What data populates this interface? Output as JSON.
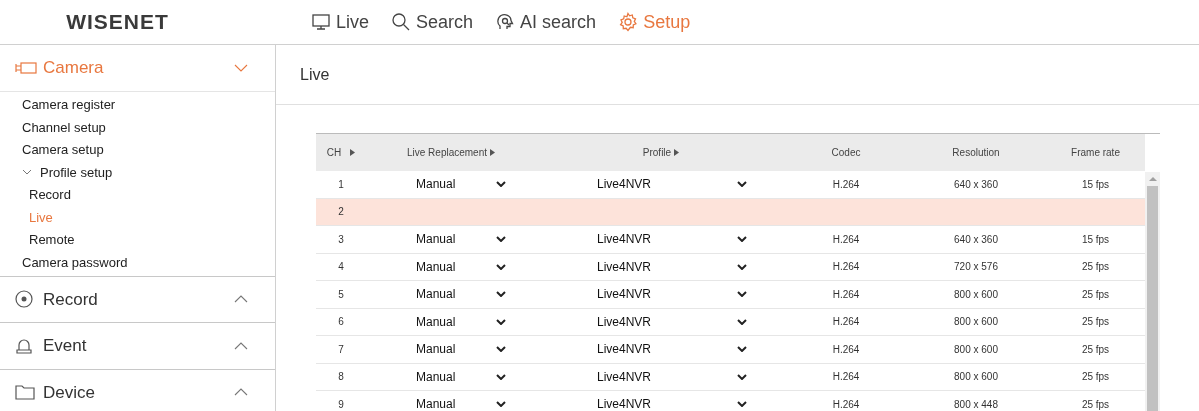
{
  "header": {
    "logo": "WISENET",
    "nav": [
      {
        "label": "Live",
        "selected": false
      },
      {
        "label": "Search",
        "selected": false
      },
      {
        "label": "AI search",
        "selected": false
      },
      {
        "label": "Setup",
        "selected": true
      }
    ]
  },
  "sidebar": {
    "sections": [
      {
        "label": "Camera",
        "expanded": true,
        "items": [
          {
            "label": "Camera register",
            "selected": false
          },
          {
            "label": "Channel setup",
            "selected": false
          },
          {
            "label": "Camera setup",
            "selected": false
          },
          {
            "label": "Profile setup",
            "selected": false,
            "expanded": true,
            "children": [
              {
                "label": "Record",
                "selected": false
              },
              {
                "label": "Live",
                "selected": true
              },
              {
                "label": "Remote",
                "selected": false
              }
            ]
          },
          {
            "label": "Camera password",
            "selected": false
          }
        ]
      },
      {
        "label": "Record",
        "expanded": false
      },
      {
        "label": "Event",
        "expanded": false
      },
      {
        "label": "Device",
        "expanded": false
      }
    ]
  },
  "page_title": "Live",
  "table": {
    "columns": [
      {
        "label": "CH",
        "sortable": true
      },
      {
        "label": "Live Replacement",
        "sortable": true
      },
      {
        "label": "Profile",
        "sortable": true
      },
      {
        "label": "Codec",
        "sortable": false
      },
      {
        "label": "Resolution",
        "sortable": false
      },
      {
        "label": "Frame rate",
        "sortable": false
      }
    ],
    "rows": [
      {
        "ch": "1",
        "selected": false,
        "replacement": "Manual",
        "profile": "Live4NVR",
        "codec": "H.264",
        "resolution": "640 x 360",
        "frame_rate": "15 fps"
      },
      {
        "ch": "2",
        "selected": true
      },
      {
        "ch": "3",
        "selected": false,
        "replacement": "Manual",
        "profile": "Live4NVR",
        "codec": "H.264",
        "resolution": "640 x 360",
        "frame_rate": "15 fps"
      },
      {
        "ch": "4",
        "selected": false,
        "replacement": "Manual",
        "profile": "Live4NVR",
        "codec": "H.264",
        "resolution": "720 x 576",
        "frame_rate": "25 fps"
      },
      {
        "ch": "5",
        "selected": false,
        "replacement": "Manual",
        "profile": "Live4NVR",
        "codec": "H.264",
        "resolution": "800 x 600",
        "frame_rate": "25 fps"
      },
      {
        "ch": "6",
        "selected": false,
        "replacement": "Manual",
        "profile": "Live4NVR",
        "codec": "H.264",
        "resolution": "800 x 600",
        "frame_rate": "25 fps"
      },
      {
        "ch": "7",
        "selected": false,
        "replacement": "Manual",
        "profile": "Live4NVR",
        "codec": "H.264",
        "resolution": "800 x 600",
        "frame_rate": "25 fps"
      },
      {
        "ch": "8",
        "selected": false,
        "replacement": "Manual",
        "profile": "Live4NVR",
        "codec": "H.264",
        "resolution": "800 x 600",
        "frame_rate": "25 fps"
      },
      {
        "ch": "9",
        "selected": false,
        "replacement": "Manual",
        "profile": "Live4NVR",
        "codec": "H.264",
        "resolution": "800 x 448",
        "frame_rate": "25 fps"
      }
    ]
  }
}
